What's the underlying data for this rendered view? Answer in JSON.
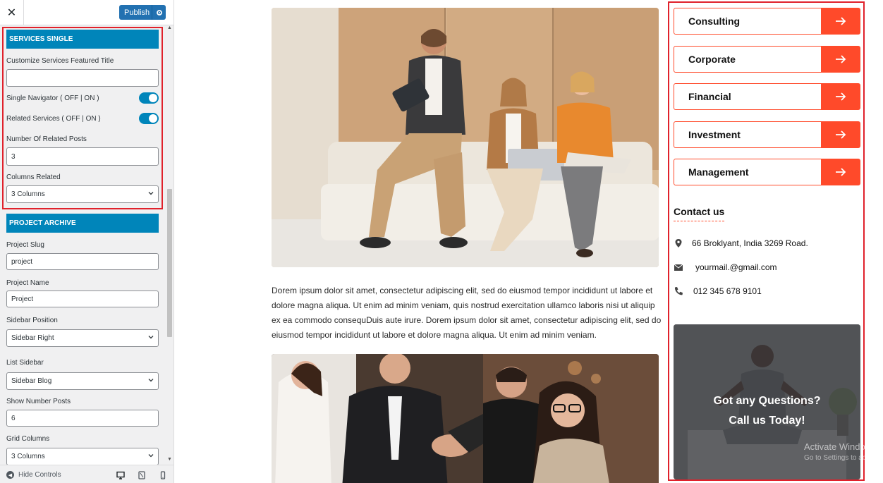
{
  "panel": {
    "close_label": "✕",
    "publish_label": "Publish",
    "services_single": {
      "heading": "SERVICES SINGLE",
      "featured_title_label": "Customize Services Featured Title",
      "featured_title_value": "",
      "single_navigator_label": "Single Navigator ( OFF | ON )",
      "single_navigator_on": true,
      "related_services_label": "Related Services ( OFF | ON )",
      "related_services_on": true,
      "related_posts_label": "Number Of Related Posts",
      "related_posts_value": "3",
      "columns_related_label": "Columns Related",
      "columns_related_value": "3 Columns"
    },
    "project_archive": {
      "heading": "PROJECT ARCHIVE",
      "slug_label": "Project Slug",
      "slug_value": "project",
      "name_label": "Project Name",
      "name_value": "Project",
      "sidebar_position_label": "Sidebar Position",
      "sidebar_position_value": "Sidebar Right",
      "list_sidebar_label": "List Sidebar",
      "list_sidebar_value": "Sidebar Blog",
      "show_posts_label": "Show Number Posts",
      "show_posts_value": "6",
      "grid_columns_label": "Grid Columns",
      "grid_columns_value": "3 Columns"
    },
    "footer": {
      "hide_controls_label": "Hide Controls"
    }
  },
  "preview": {
    "article_text": "Dorem ipsum dolor sit amet, consectetur adipiscing elit, sed do eiusmod tempor incididunt ut labore et dolore magna aliqua. Ut enim ad minim veniam, quis nostrud exercitation ullamco laboris nisi ut aliquip ex ea commodo consequDuis aute irure. Dorem ipsum dolor sit amet, consectetur adipiscing elit, sed do eiusmod tempor incididunt ut labore et dolore magna aliqua. Ut enim ad minim veniam.",
    "services": [
      "Consulting",
      "Corporate",
      "Financial",
      "Investment",
      "Management"
    ],
    "contact": {
      "title": "Contact us",
      "address": "66 Broklyant, India 3269 Road.",
      "email": "yourmail.@gmail.com",
      "phone": "012 345 678 9101"
    },
    "cta": {
      "line1": "Got any Questions?",
      "line2": "Call us Today!"
    },
    "watermark": {
      "line1": "Activate Windows",
      "line2": "Go to Settings to activa"
    }
  },
  "colors": {
    "accent": "#ff4a2a",
    "wp_blue": "#0085ba",
    "highlight_red": "#e0212b"
  }
}
